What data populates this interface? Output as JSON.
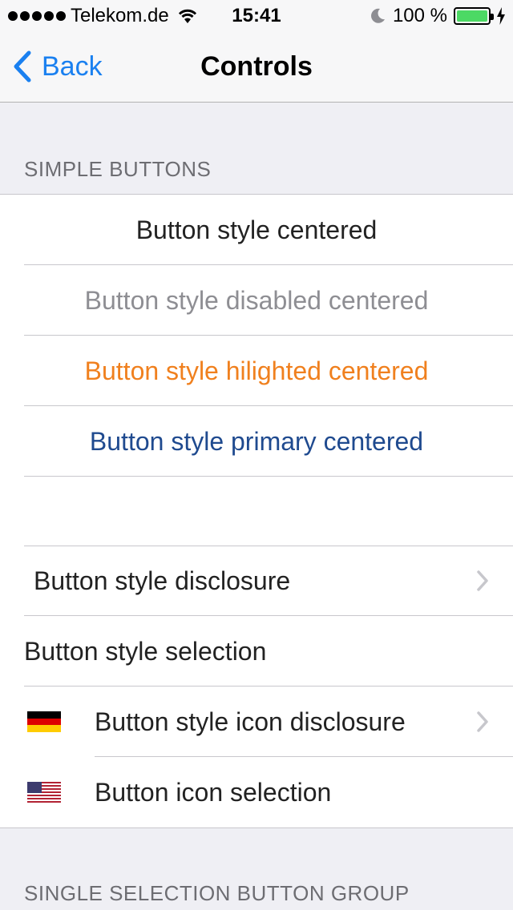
{
  "status_bar": {
    "carrier": "Telekom.de",
    "time": "15:41",
    "battery": "100 %",
    "battery_level": 1.0,
    "icons": [
      "signal-dots-icon",
      "wifi-icon",
      "moon-icon",
      "battery-icon",
      "charging-bolt-icon"
    ]
  },
  "nav": {
    "back_label": "Back",
    "title": "Controls"
  },
  "sections": {
    "simple_buttons_header": "SIMPLE BUTTONS",
    "single_selection_header": "SINGLE SELECTION BUTTON GROUP"
  },
  "centered_buttons": [
    {
      "label": "Button style centered",
      "style": "plain"
    },
    {
      "label": "Button style disabled centered",
      "style": "disabled"
    },
    {
      "label": "Button style hilighted centered",
      "style": "hilighted"
    },
    {
      "label": "Button style primary centered",
      "style": "primary"
    }
  ],
  "list_buttons": [
    {
      "label": "Button style disclosure",
      "accessory": "chevron"
    },
    {
      "label": "Button style selection",
      "accessory": "none"
    },
    {
      "label": "Button style icon disclosure",
      "icon": "germany-flag-icon",
      "accessory": "chevron"
    },
    {
      "label": "Button icon selection",
      "icon": "us-flag-icon",
      "accessory": "none"
    }
  ],
  "colors": {
    "tint": "#1a80f0",
    "hilighted": "#f0801e",
    "primary": "#1f4a8f",
    "disabled": "#8e8e93",
    "battery_green": "#4cd964"
  }
}
